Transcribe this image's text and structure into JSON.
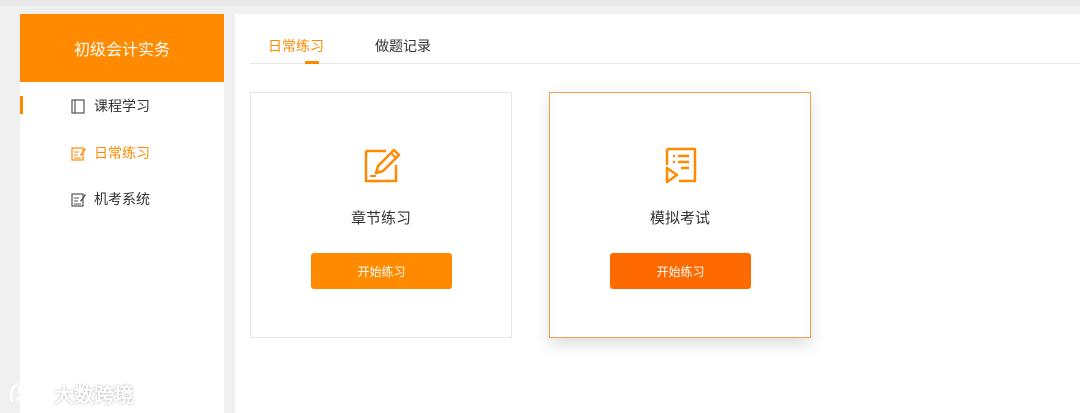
{
  "sidebar": {
    "title": "初级会计实务",
    "items": [
      {
        "label": "课程学习",
        "icon": "book-icon"
      },
      {
        "label": "日常练习",
        "icon": "edit-icon"
      },
      {
        "label": "机考系统",
        "icon": "edit-icon"
      }
    ],
    "active_index": 1
  },
  "tabs": [
    {
      "label": "日常练习"
    },
    {
      "label": "做题记录"
    }
  ],
  "cards": [
    {
      "title": "章节练习",
      "button": "开始练习",
      "icon": "pencil-paper-icon"
    },
    {
      "title": "模拟考试",
      "button": "开始练习",
      "icon": "exam-list-icon"
    }
  ],
  "watermark": {
    "text": "大数跨境"
  },
  "colors": {
    "accent": "#ff8a00",
    "button_primary": "#ff8a00",
    "button_hover": "#ff6a00",
    "background": "#f0f0f0"
  }
}
